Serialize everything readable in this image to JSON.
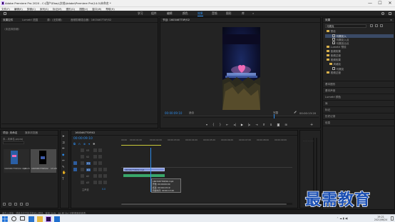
{
  "window": {
    "title": "Adobe Premiere Pro 2020 - C:\\用户\\Ebay\\文档\\Adobe\\Premiere Pro\\14.0\\未命名 *",
    "minimize": "—",
    "maximize": "☐",
    "close": "✕"
  },
  "menu": [
    "文件(F)",
    "编辑(E)",
    "剪辑(C)",
    "序列(S)",
    "标记(M)",
    "图形(G)",
    "视图(V)",
    "窗口(W)",
    "帮助(H)"
  ],
  "workspaces": [
    "学习",
    "组件",
    "编辑",
    "颜色",
    "效果",
    "音频",
    "图形",
    "库"
  ],
  "active_workspace": "效果",
  "source_panel": {
    "tabs": [
      "效果控件",
      "Lumetri 范围",
      "源：(无剪辑)",
      "音频剪辑混合器：1603467T0P/02"
    ],
    "message": "（未选择剪辑）"
  },
  "program_monitor": {
    "tab": "节目: 1603467T0P/02",
    "timecode": "00:00:09:10",
    "fit": "适合",
    "quality": "完整",
    "duration": "00:00:13:20",
    "zoom_label": "1/2"
  },
  "effects_panel": {
    "tab": "效果",
    "search": "马赛克",
    "tree": [
      {
        "label": "预设",
        "level": 0
      },
      {
        "label": "马赛克入",
        "level": 2,
        "selected": true
      },
      {
        "label": "马赛克入点",
        "level": 2
      },
      {
        "label": "马赛克出点",
        "level": 2
      },
      {
        "label": "Lumetri 预设",
        "level": 0
      },
      {
        "label": "音频效果",
        "level": 0
      },
      {
        "label": "音频过渡",
        "level": 0
      },
      {
        "label": "视频效果",
        "level": 0
      },
      {
        "label": "风格化",
        "level": 1
      },
      {
        "label": "马赛克",
        "level": 2
      },
      {
        "label": "视频过渡",
        "level": 0
      }
    ],
    "side_panels": [
      "基本图形",
      "基本声音",
      "Lumetri 颜色",
      "库",
      "标记",
      "历史记录",
      "信息"
    ]
  },
  "project_panel": {
    "tabs": [
      "项目: 未命名",
      "媒体浏览器"
    ],
    "path": "未...未命名.prproj",
    "items": [
      {
        "name": "1603467T0P/02.mp4",
        "duration": "13:20"
      },
      {
        "name": "1603467T0P/02",
        "duration": "13:20"
      }
    ]
  },
  "timeline": {
    "tab": "1603467T0P/02",
    "timecode": "00:00:09:10",
    "ruler": [
      "00:00",
      "00:00:01:00",
      "00:00:02:00",
      "00:00:03:00",
      "00:00:04:00",
      "00:00:05:00",
      "00:00:06:00",
      "00:00:07:00",
      "00:00:08:00",
      "00:00:09:00",
      "00:00:10:00",
      "00:00:11:00",
      "00:00:12:00",
      "00:00:13:00"
    ],
    "tracks": [
      "V3",
      "V2",
      "V1",
      "A1",
      "A2",
      "A3"
    ],
    "master": "主声道",
    "master_value": "0.0",
    "tooltip": [
      "1603467T0P/02.mp4",
      "开始: 00:00:00:00",
      "结束: 00:00:13:19",
      "持续时间: 00:00:13:20"
    ]
  },
  "status_bar": "单击以选择，或单击空白处并拖动以框选。使用 Shift、Alt 和 Ctrl 可获得其他选项。",
  "watermark": "最需教育",
  "clock": {
    "time": "19:21",
    "date": "2021/06/24"
  },
  "colors": {
    "accent": "#2d8ceb",
    "clip_video": "#7a8fd8",
    "clip_audio": "#39a66a",
    "playhead": "#2d8ceb"
  }
}
